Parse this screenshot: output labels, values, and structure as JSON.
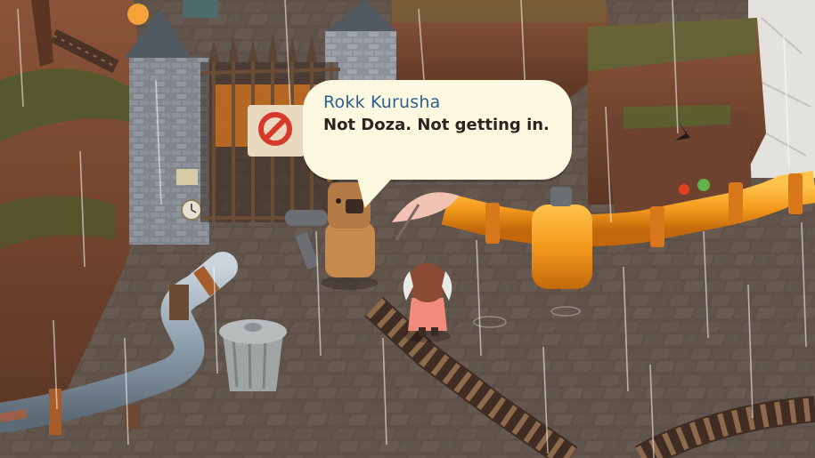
{
  "dialogue": {
    "speaker": "Rokk Kurusha",
    "text": "Not Doza. Not getting in."
  },
  "colors": {
    "dialog_bg": "#fdf8e0",
    "speaker_name": "#2d5f91",
    "dialog_text": "#2b2420",
    "pipe_orange": "#f39a1c",
    "pipe_gray": "#8fa0ad",
    "ground": "#6e5f55",
    "cliff": "#7a4a33"
  }
}
